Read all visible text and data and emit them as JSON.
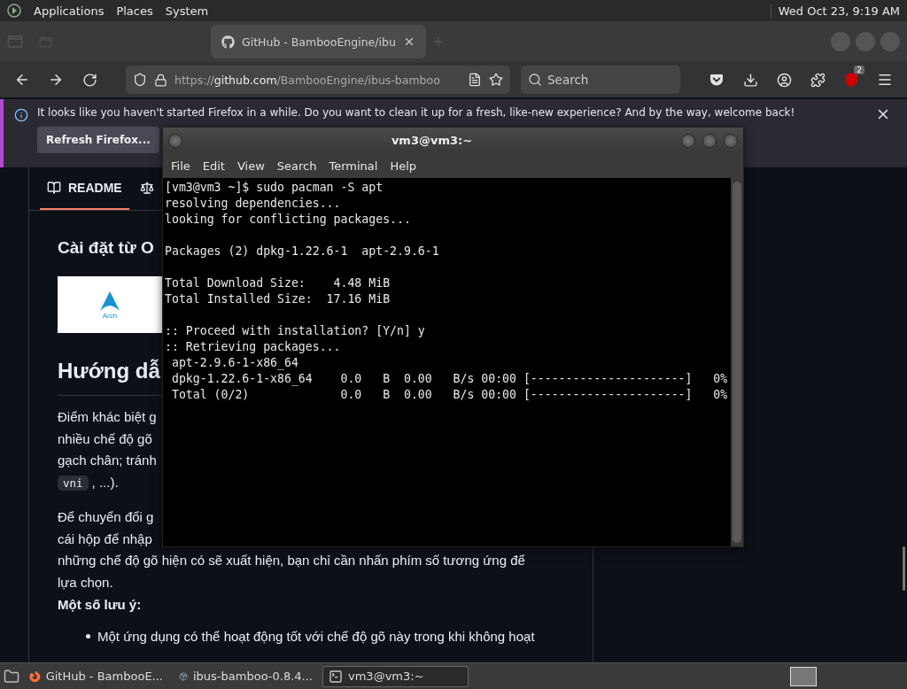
{
  "top_panel": {
    "menus": [
      "Applications",
      "Places",
      "System"
    ],
    "clock": "Wed Oct 23, 9:19 AM"
  },
  "browser": {
    "tabs": [
      {
        "selected": false
      },
      {
        "title": "GitHub - BambooEngine/ibu",
        "selected": true
      }
    ],
    "url": {
      "scheme": "https://",
      "host": "github.com",
      "path": "/BambooEngine/ibus-bamboo"
    },
    "search_placeholder": "Search",
    "extension_badge": "2"
  },
  "notification": {
    "message": "It looks like you haven't started Firefox in a while. Do you want to clean it up for a fresh, like-new experience? And by the way, welcome back!",
    "button": "Refresh Firefox..."
  },
  "readme": {
    "tabs": [
      {
        "label": "README",
        "selected": true
      },
      {
        "selected": false
      }
    ],
    "heading": "Cài đặt từ O",
    "logo_caption": "Arch",
    "section_title": "Hướng dẫ",
    "paragraphs": [
      [
        {
          "text": "Điểm khác biệt g"
        },
        {
          "text": "nhiều chế độ gõ"
        },
        {
          "text": "gạch chân; tránh"
        },
        {
          "code": "vni",
          "text": ", ...)."
        }
      ],
      [
        {
          "text": "Để chuyển đổi g"
        },
        {
          "text": "cái hộp để nhập"
        },
        {
          "text": "những chế độ gõ hiện có sẽ xuất hiện, bạn chỉ cần nhấn phím số tương ứng để"
        },
        {
          "text": "lựa chọn."
        }
      ]
    ],
    "notes_title": "Một số lưu ý:",
    "bullets": [
      "Một ứng dụng có thể hoạt động tốt với chế độ gõ này trong khi không hoạt"
    ]
  },
  "terminal": {
    "title": "vm3@vm3:~",
    "menus": [
      "File",
      "Edit",
      "View",
      "Search",
      "Terminal",
      "Help"
    ],
    "blocks": [
      [
        "[vm3@vm3 ~]$ sudo pacman -S apt",
        "resolving dependencies...",
        "looking for conflicting packages..."
      ],
      [
        "Packages (2) dpkg-1.22.6-1  apt-2.9.6-1"
      ],
      [
        "Total Download Size:    4.48 MiB",
        "Total Installed Size:  17.16 MiB"
      ],
      [
        ":: Proceed with installation? [Y/n] y",
        ":: Retrieving packages...",
        " apt-2.9.6-1-x86_64",
        " dpkg-1.22.6-1-x86_64    0.0   B  0.00   B/s 00:00 [----------------------]   0%",
        " Total (0/2)             0.0   B  0.00   B/s 00:00 [----------------------]   0%"
      ]
    ]
  },
  "taskbar": {
    "tasks": [
      {
        "label": "GitHub - BambooE...",
        "kind": "browser",
        "selected": false
      },
      {
        "label": "ibus-bamboo-0.8.4...",
        "kind": "package",
        "selected": false
      },
      {
        "label": "vm3@vm3:~",
        "kind": "terminal",
        "selected": true
      }
    ]
  }
}
